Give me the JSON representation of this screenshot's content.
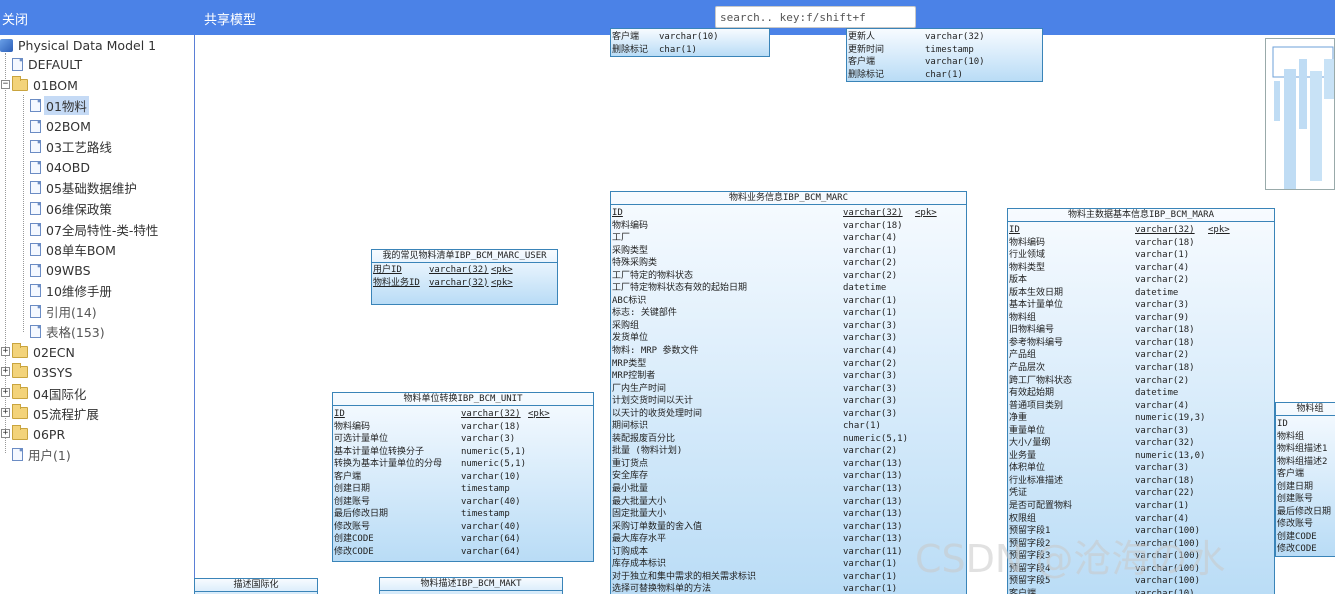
{
  "header": {
    "close_label": "关闭",
    "model_title": "共享模型",
    "search_placeholder": "search.. key:f/shift+f"
  },
  "tree": {
    "root": "Physical Data Model 1",
    "items": [
      {
        "label": "DEFAULT"
      },
      {
        "label": "01BOM"
      },
      {
        "label": "01物料"
      },
      {
        "label": "02BOM"
      },
      {
        "label": "03工艺路线"
      },
      {
        "label": "04OBD"
      },
      {
        "label": "05基础数据维护"
      },
      {
        "label": "06维保政策"
      },
      {
        "label": "07全局特性-类-特性"
      },
      {
        "label": "08单车BOM"
      },
      {
        "label": "09WBS"
      },
      {
        "label": "10维修手册"
      },
      {
        "label": "引用(14)"
      },
      {
        "label": "表格(153)"
      },
      {
        "label": "02ECN"
      },
      {
        "label": "03SYS"
      },
      {
        "label": "04国际化"
      },
      {
        "label": "05流程扩展"
      },
      {
        "label": "06PR"
      },
      {
        "label": "用户(1)"
      }
    ]
  },
  "tables": {
    "top_left_partial": {
      "rows": [
        [
          "客户端",
          "varchar(10)",
          ""
        ],
        [
          "删除标记",
          "char(1)",
          ""
        ]
      ]
    },
    "top_right_partial": {
      "rows": [
        [
          "更新人",
          "varchar(32)",
          ""
        ],
        [
          "更新时间",
          "timestamp",
          ""
        ],
        [
          "客户端",
          "varchar(10)",
          ""
        ],
        [
          "删除标记",
          "char(1)",
          ""
        ]
      ]
    },
    "marc_user": {
      "title": "我的常见物料清单IBP_BCM_MARC_USER",
      "rows": [
        [
          "用户ID",
          "varchar(32)",
          "<pk>"
        ],
        [
          "物料业务ID",
          "varchar(32)",
          "<pk>"
        ]
      ]
    },
    "unit": {
      "title": "物料单位转换IBP_BCM_UNIT",
      "rows": [
        [
          "ID",
          "varchar(32)",
          "<pk>"
        ],
        [
          "物料编码",
          "varchar(18)",
          ""
        ],
        [
          "可选计量单位",
          "varchar(3)",
          ""
        ],
        [
          "基本计量单位转换分子",
          "numeric(5,1)",
          ""
        ],
        [
          "转换为基本计量单位的分母",
          "numeric(5,1)",
          ""
        ],
        [
          "客户端",
          "varchar(10)",
          ""
        ],
        [
          "创建日期",
          "timestamp",
          ""
        ],
        [
          "创建账号",
          "varchar(40)",
          ""
        ],
        [
          "最后修改日期",
          "timestamp",
          ""
        ],
        [
          "修改账号",
          "varchar(40)",
          ""
        ],
        [
          "创建CODE",
          "varchar(64)",
          ""
        ],
        [
          "修改CODE",
          "varchar(64)",
          ""
        ]
      ]
    },
    "marc": {
      "title": "物料业务信息IBP_BCM_MARC",
      "rows": [
        [
          "ID",
          "varchar(32)",
          "<pk>"
        ],
        [
          "物料编码",
          "varchar(18)",
          ""
        ],
        [
          "工厂",
          "varchar(4)",
          ""
        ],
        [
          "采购类型",
          "varchar(1)",
          ""
        ],
        [
          "特殊采购类",
          "varchar(2)",
          ""
        ],
        [
          "工厂特定的物料状态",
          "varchar(2)",
          ""
        ],
        [
          "工厂特定物料状态有效的起始日期",
          "datetime",
          ""
        ],
        [
          "ABC标识",
          "varchar(1)",
          ""
        ],
        [
          "标志: 关键部件",
          "varchar(1)",
          ""
        ],
        [
          "采购组",
          "varchar(3)",
          ""
        ],
        [
          "发货单位",
          "varchar(3)",
          ""
        ],
        [
          "物料: MRP 参数文件",
          "varchar(4)",
          ""
        ],
        [
          "MRP类型",
          "varchar(2)",
          ""
        ],
        [
          "MRP控制者",
          "varchar(3)",
          ""
        ],
        [
          "厂内生产时间",
          "varchar(3)",
          ""
        ],
        [
          "计划交货时间以天计",
          "varchar(3)",
          ""
        ],
        [
          "以天计的收货处理时间",
          "varchar(3)",
          ""
        ],
        [
          "期间标识",
          "char(1)",
          ""
        ],
        [
          "装配报废百分比",
          "numeric(5,1)",
          ""
        ],
        [
          "批量 (物料计划)",
          "varchar(2)",
          ""
        ],
        [
          "重订货点",
          "varchar(13)",
          ""
        ],
        [
          "安全库存",
          "varchar(13)",
          ""
        ],
        [
          "最小批量",
          "varchar(13)",
          ""
        ],
        [
          "最大批量大小",
          "varchar(13)",
          ""
        ],
        [
          "固定批量大小",
          "varchar(13)",
          ""
        ],
        [
          "采购订单数量的舍入值",
          "varchar(13)",
          ""
        ],
        [
          "最大库存水平",
          "varchar(13)",
          ""
        ],
        [
          "订购成本",
          "varchar(11)",
          ""
        ],
        [
          "库存成本标识",
          "varchar(1)",
          ""
        ],
        [
          "对于独立和集中需求的相关需求标识",
          "varchar(1)",
          ""
        ],
        [
          "选择可替换物料单的方法",
          "varchar(1)",
          ""
        ]
      ]
    },
    "mara": {
      "title": "物料主数据基本信息IBP_BCM_MARA",
      "rows": [
        [
          "ID",
          "varchar(32)",
          "<pk>"
        ],
        [
          "物料编码",
          "varchar(18)",
          ""
        ],
        [
          "行业领域",
          "varchar(1)",
          ""
        ],
        [
          "物料类型",
          "varchar(4)",
          ""
        ],
        [
          "版本",
          "varchar(2)",
          ""
        ],
        [
          "版本生效日期",
          "datetime",
          ""
        ],
        [
          "基本计量单位",
          "varchar(3)",
          ""
        ],
        [
          "物料组",
          "varchar(9)",
          ""
        ],
        [
          "旧物料编号",
          "varchar(18)",
          ""
        ],
        [
          "参考物料编号",
          "varchar(18)",
          ""
        ],
        [
          "产品组",
          "varchar(2)",
          ""
        ],
        [
          "产品层次",
          "varchar(18)",
          ""
        ],
        [
          "跨工厂物料状态",
          "varchar(2)",
          ""
        ],
        [
          "有效起始期",
          "datetime",
          ""
        ],
        [
          "普通项目类别",
          "varchar(4)",
          ""
        ],
        [
          "净重",
          "numeric(19,3)",
          ""
        ],
        [
          "重量单位",
          "varchar(3)",
          ""
        ],
        [
          "大小/量纲",
          "varchar(32)",
          ""
        ],
        [
          "业务量",
          "numeric(13,0)",
          ""
        ],
        [
          "体积单位",
          "varchar(3)",
          ""
        ],
        [
          "行业标准描述",
          "varchar(18)",
          ""
        ],
        [
          "凭证",
          "varchar(22)",
          ""
        ],
        [
          "是否可配置物料",
          "varchar(1)",
          ""
        ],
        [
          "权限组",
          "varchar(4)",
          ""
        ],
        [
          "预留字段1",
          "varchar(100)",
          ""
        ],
        [
          "预留字段2",
          "varchar(100)",
          ""
        ],
        [
          "预留字段3",
          "varchar(100)",
          ""
        ],
        [
          "预留字段4",
          "varchar(100)",
          ""
        ],
        [
          "预留字段5",
          "varchar(100)",
          ""
        ],
        [
          "客户端",
          "varchar(10)",
          ""
        ]
      ]
    },
    "right_partial": {
      "title": "物料组",
      "rows": [
        [
          "ID",
          "",
          ""
        ],
        [
          "物料组",
          "",
          ""
        ],
        [
          "物料组描述1",
          "",
          ""
        ],
        [
          "物料组描述2",
          "",
          ""
        ],
        [
          "客户端",
          "",
          ""
        ],
        [
          "创建日期",
          "",
          ""
        ],
        [
          "创建账号",
          "",
          ""
        ],
        [
          "最后修改日期",
          "",
          ""
        ],
        [
          "修改账号",
          "",
          ""
        ],
        [
          "创建CODE",
          "",
          ""
        ],
        [
          "修改CODE",
          "",
          ""
        ]
      ]
    },
    "bottom_left_partial": {
      "title": "描述国际化"
    },
    "makt": {
      "title": "物料描述IBP_BCM_MAKT"
    }
  },
  "watermark": "CSDN @沧海の水"
}
